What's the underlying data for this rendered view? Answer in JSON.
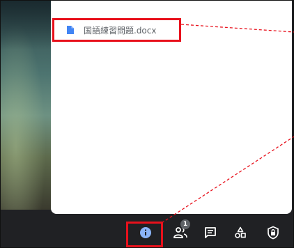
{
  "attachment": {
    "file_name": "国語練習問題.docx",
    "icon": "doc-icon",
    "icon_color": "#4285f4"
  },
  "toolbar": {
    "buttons": [
      {
        "name": "info",
        "icon": "info-icon",
        "color": "#8ab4f8"
      },
      {
        "name": "people",
        "icon": "people-icon",
        "badge": "1"
      },
      {
        "name": "chat",
        "icon": "chat-icon"
      },
      {
        "name": "activities",
        "icon": "shapes-icon"
      },
      {
        "name": "host-controls",
        "icon": "shield-lock-icon"
      }
    ]
  },
  "colors": {
    "highlight": "#e8111c",
    "toolbar_bg": "#202124",
    "panel_bg": "#ffffff"
  }
}
